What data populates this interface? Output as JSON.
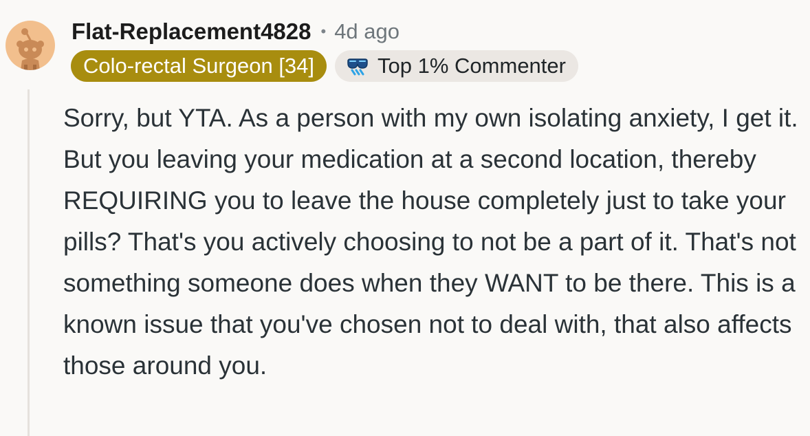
{
  "comment": {
    "author": "Flat-Replacement4828",
    "separator": "•",
    "time_ago": "4d ago",
    "user_flair": "Colo-rectal Surgeon [34]",
    "achievement_flair": "Top 1% Commenter",
    "achievement_icon": "sunglasses-badge-icon",
    "avatar_icon": "snoo-avatar-icon",
    "body": "Sorry, but YTA. As a person with my own isolating anxiety, I get it. But you leaving your medication at a second location, thereby REQUIRING you to leave the house completely just to take your pills? That's you actively choosing to not be a part of it. That's not something someone does when they WANT to be there. This is a known issue that you've chosen not to deal with, that also affects those around you."
  },
  "colors": {
    "background": "#faf9f7",
    "user_flair_bg": "#a88d0f",
    "achievement_flair_bg": "#ebe7e3",
    "avatar_bg": "#f2bf8d",
    "thread_line": "#e5e1dd"
  }
}
